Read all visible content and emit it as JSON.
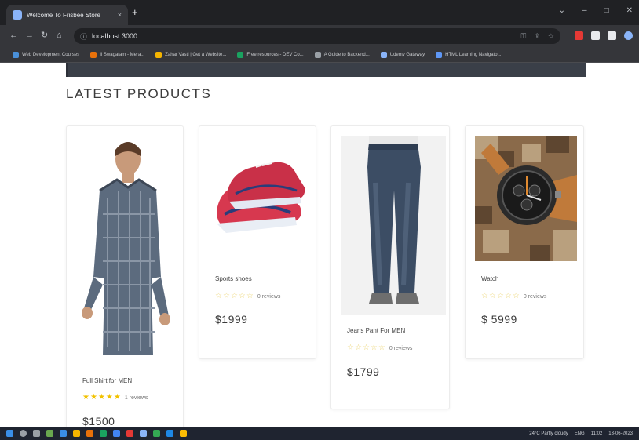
{
  "browser": {
    "tab_title": "Welcome To Frisbee Store",
    "tab_close": "×",
    "new_tab": "+",
    "url": "localhost:3000",
    "info_icon": "info-icon",
    "bookmarks": [
      {
        "label": "Web Development Courses",
        "color": "#4a90d9"
      },
      {
        "label": "Il Swagatam - Mera...",
        "color": "#e8710a"
      },
      {
        "label": "Zahar Vasti | Get a Website...",
        "color": "#f4b400"
      },
      {
        "label": "Free resources - DEV Co...",
        "color": "#1aa260"
      },
      {
        "label": "A Guide to Backend...",
        "color": "#9aa0a6"
      },
      {
        "label": "Udemy Gateway",
        "color": "#8ab4f8"
      },
      {
        "label": "HTML Learning Navigator...",
        "color": "#5e97f6"
      }
    ],
    "extensions": [
      "#e53935",
      "#e8eaed",
      "#e8eaed",
      "#8ab4f8"
    ]
  },
  "page": {
    "section_title": "LATEST PRODUCTS",
    "products": [
      {
        "name": "Full Shirt for MEN",
        "rating": 5,
        "reviews_text": "1 reviews",
        "price": "$1500",
        "image": "shirt-image"
      },
      {
        "name": "Sports shoes",
        "rating": 0,
        "reviews_text": "0 reviews",
        "price": "$1999",
        "image": "shoes-image"
      },
      {
        "name": "Jeans Pant For MEN",
        "rating": 0,
        "reviews_text": "0 reviews",
        "price": "$1799",
        "image": "jeans-image"
      },
      {
        "name": "Watch",
        "rating": 0,
        "reviews_text": "0 reviews",
        "price": "$ 5999",
        "image": "watch-image"
      }
    ]
  },
  "taskbar": {
    "weather": "24°C Partly cloudy",
    "language": "ENG",
    "time": "11:02",
    "date": "13-06-2023"
  }
}
